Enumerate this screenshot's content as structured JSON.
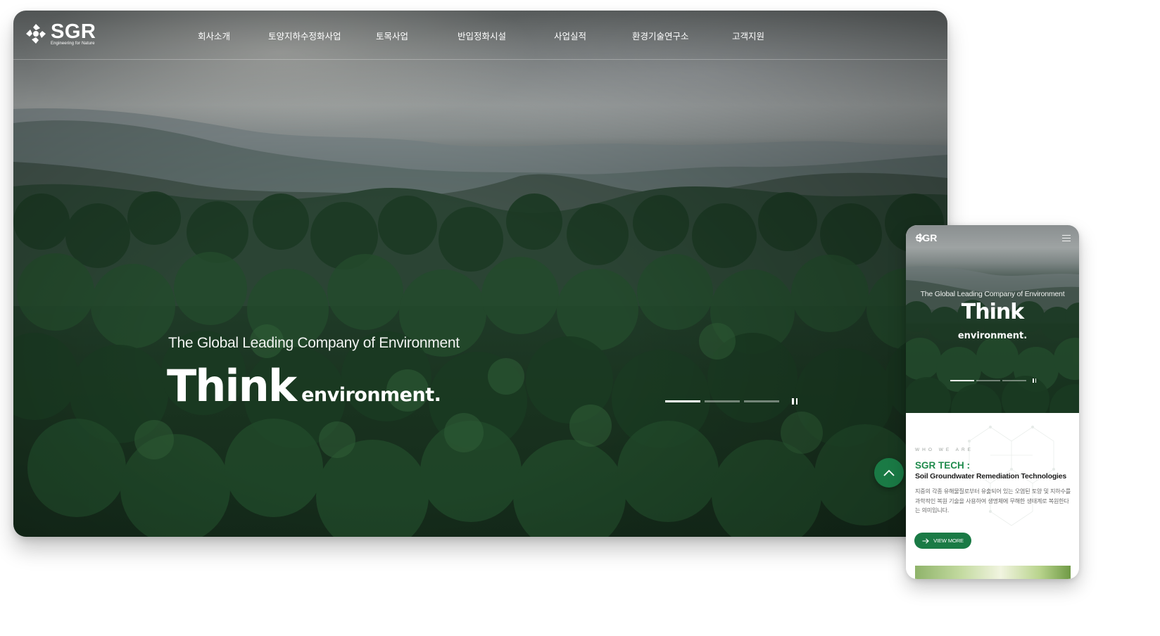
{
  "desktop": {
    "logo": {
      "brand": "SGR",
      "tagline": "Engineering for Nature"
    },
    "nav": [
      {
        "label": "회사소개"
      },
      {
        "label": "토양지하수정화사업"
      },
      {
        "label": "토목사업"
      },
      {
        "label": "반입정화시설"
      },
      {
        "label": "사업실적"
      },
      {
        "label": "환경기술연구소"
      },
      {
        "label": "고객지원"
      }
    ],
    "hero": {
      "subtitle": "The Global Leading Company of Environment",
      "title_big": "Think",
      "title_small": "environment.",
      "slides_total": 3,
      "slide_active": 1
    }
  },
  "mobile": {
    "logo": {
      "brand": "SGR"
    },
    "hero": {
      "subtitle": "The Global Leading Company of Environment",
      "title_big": "Think",
      "title_small": "environment."
    },
    "about": {
      "eyebrow": "WHO WE ARE",
      "title": "SGR TECH :",
      "subtitle": "Soil Groundwater Remediation Technologies",
      "description": "지중의 각종 유해물질로부터 유출되어 있는 오염된 토양 및 지하수를 과학적인 복원 기술을 사용하여 생명체에 무해한 생태계로 복원한다는 의미입니다.",
      "button_label": "VIEW MORE"
    }
  },
  "colors": {
    "accent_green": "#1a7a45",
    "title_green": "#1f8b4c"
  },
  "icons": [
    "sgr-logo-icon",
    "arrow-up-icon",
    "pause-icon",
    "hamburger-menu-icon",
    "arrow-right-icon"
  ]
}
